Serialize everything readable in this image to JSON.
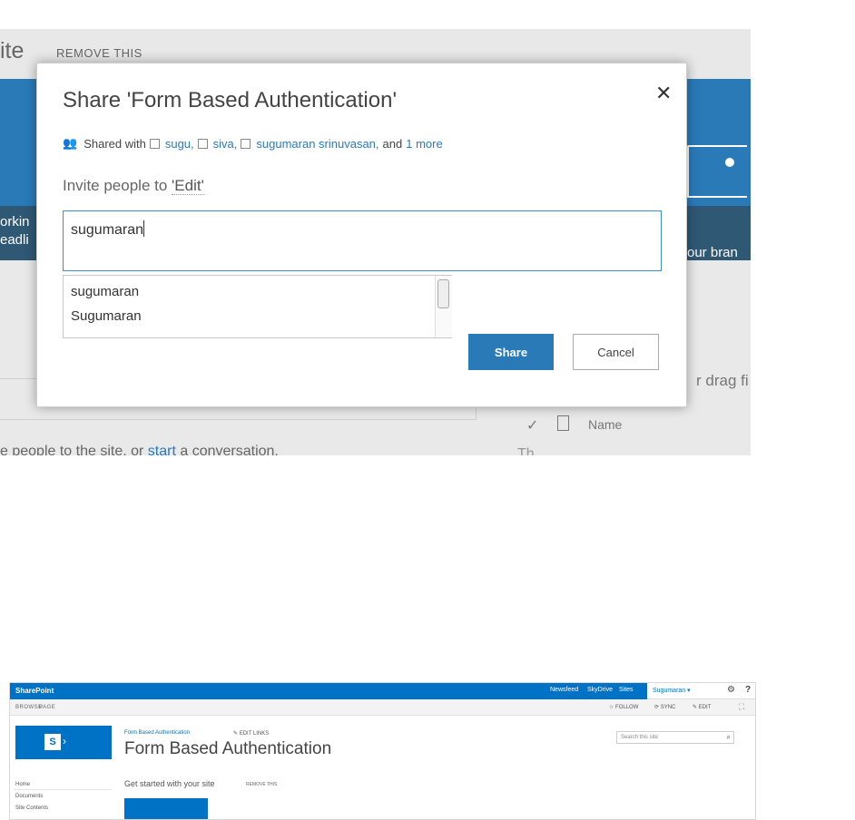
{
  "top_screenshot": {
    "background": {
      "site_fragment": "ite",
      "remove_this": "REMOVE THIS",
      "tile_text_left_line1": "orkin",
      "tile_text_left_line2": "eadli",
      "tile_text_right": "our bran",
      "drag_text": "r drag fi",
      "checkmark": "✓",
      "name_header": "Name",
      "bottom_text_start": "e people to the site, or ",
      "bottom_text_link": "start",
      "bottom_text_end": " a conversation.",
      "bottom_text_right": "Th"
    },
    "dialog": {
      "title": "Share 'Form Based Authentication'",
      "close_glyph": "✕",
      "shared_with_label": "Shared with",
      "people": [
        "sugu,",
        "siva,",
        "sugumaran srinuvasan,"
      ],
      "and_label": "and",
      "more_link": "1 more",
      "invite_prefix": "Invite people to ",
      "invite_permission": "'Edit'",
      "input_value": "sugumaran",
      "suggestions": [
        "sugumaran",
        "Sugumaran"
      ],
      "share_button": "Share",
      "cancel_button": "Cancel"
    },
    "colors": {
      "accent": "#2a7ab8",
      "focus_border": "#3b8fd1"
    }
  },
  "bottom_screenshot": {
    "suite_bar": {
      "brand": "SharePoint",
      "nav": [
        "Newsfeed",
        "SkyDrive",
        "Sites"
      ],
      "user": "Sugumaran ▾"
    },
    "ribbon": {
      "tabs": [
        "BROWSE",
        "PAGE"
      ],
      "follow": "☆ FOLLOW",
      "sync": "⟳ SYNC",
      "edit": "✎ EDIT",
      "focus": "⛶"
    },
    "breadcrumb": "Form Based Authentication",
    "edit_links": "✎ EDIT LINKS",
    "page_title": "Form Based Authentication",
    "search_placeholder": "Search this site",
    "sidebar": [
      "Home",
      "Documents",
      "Site Contents"
    ],
    "get_started": "Get started with your site",
    "remove_this": "REMOVE THIS",
    "colors": {
      "suite_bar": "#0072c6"
    }
  }
}
